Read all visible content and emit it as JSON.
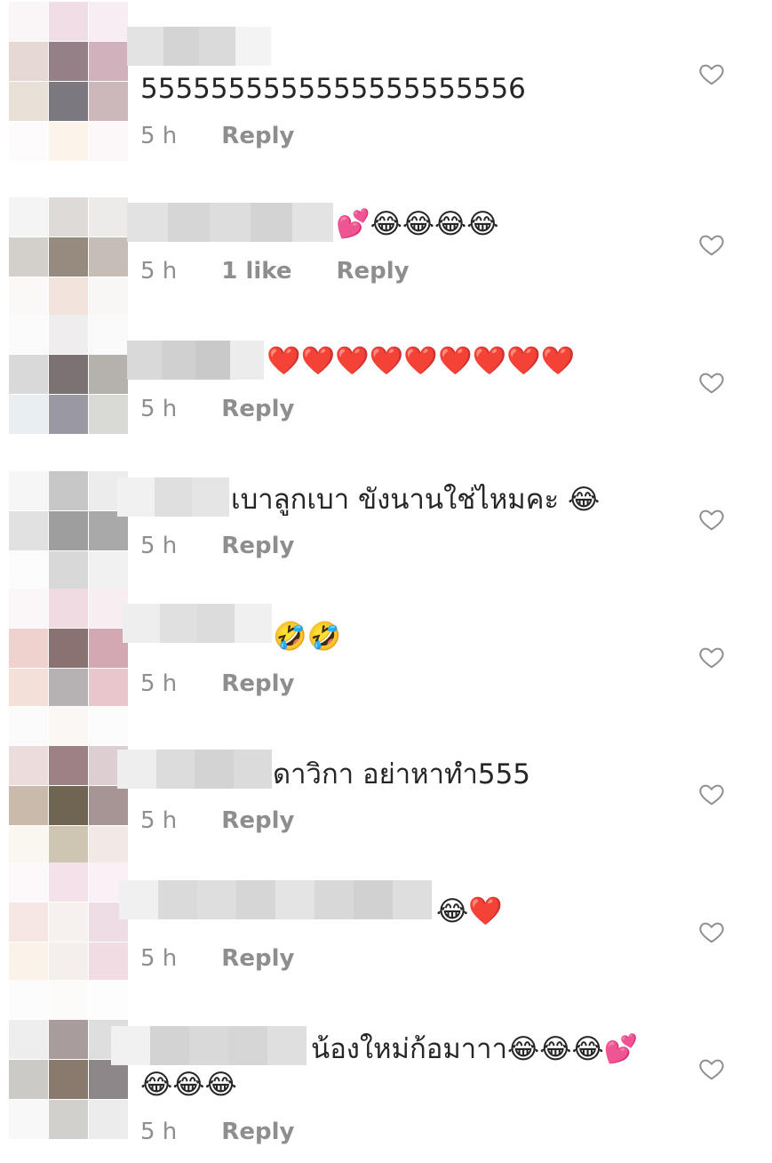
{
  "comments": [
    {
      "text": "5555555555555555555556",
      "time": "5 h",
      "likes": "",
      "reply": "Reply"
    },
    {
      "text": "💕😂😂😂😂",
      "time": "5 h",
      "likes": "1 like",
      "reply": "Reply"
    },
    {
      "text": "❤️❤️❤️❤️❤️❤️❤️❤️❤️",
      "time": "5 h",
      "likes": "",
      "reply": "Reply"
    },
    {
      "text": "เบาลูกเบา ขังนานใช่ไหมคะ 😂",
      "time": "5 h",
      "likes": "",
      "reply": "Reply"
    },
    {
      "text": "🤣🤣",
      "time": "5 h",
      "likes": "",
      "reply": "Reply"
    },
    {
      "text": "ดาวิกา อย่าหาทำ555",
      "time": "5 h",
      "likes": "",
      "reply": "Reply"
    },
    {
      "text": "😂❤️",
      "time": "5 h",
      "likes": "",
      "reply": "Reply"
    },
    {
      "text": "น้องใหม่ก้อมาาา😂😂😂💕",
      "text2": "😂😂😂",
      "time": "5 h",
      "likes": "",
      "reply": "Reply"
    }
  ]
}
